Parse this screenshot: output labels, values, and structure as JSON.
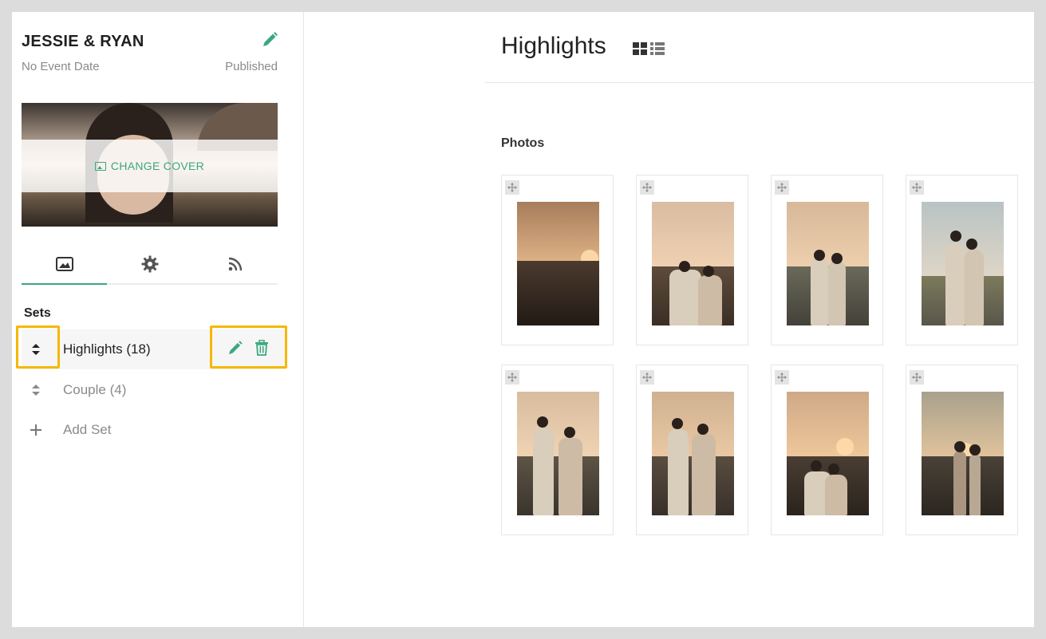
{
  "sidebar": {
    "event_title": "JESSIE & RYAN",
    "event_date": "No Event Date",
    "status": "Published",
    "change_cover_label": "CHANGE COVER",
    "tabs": [
      {
        "icon": "image-icon",
        "active": true
      },
      {
        "icon": "gear-icon",
        "active": false
      },
      {
        "icon": "rss-icon",
        "active": false
      }
    ],
    "sets_title": "Sets",
    "sets": [
      {
        "label": "Highlights (18)",
        "selected": true
      },
      {
        "label": "Couple (4)",
        "selected": false
      }
    ],
    "add_set_label": "Add Set"
  },
  "main": {
    "title": "Highlights",
    "photos_label": "Photos",
    "photo_count_shown": 8
  },
  "colors": {
    "accent": "#3aa77f",
    "highlight": "#f5b800",
    "text": "#222222",
    "muted": "#8a8a8a"
  }
}
